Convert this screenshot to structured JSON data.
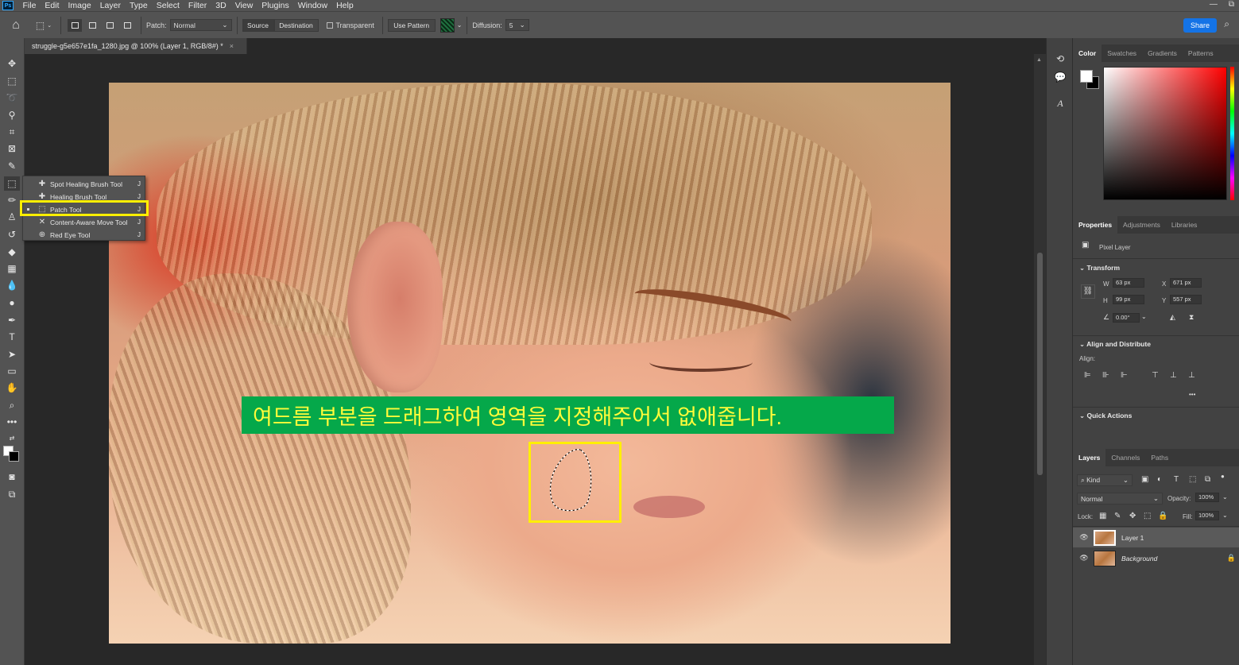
{
  "menubar": {
    "logo": "Ps",
    "items": [
      "File",
      "Edit",
      "Image",
      "Layer",
      "Type",
      "Select",
      "Filter",
      "3D",
      "View",
      "Plugins",
      "Window",
      "Help"
    ],
    "win_min": "—",
    "win_restore": "⧉"
  },
  "options": {
    "patch_label": "Patch:",
    "patch_value": "Normal",
    "source": "Source",
    "destination": "Destination",
    "transparent": "Transparent",
    "use_pattern": "Use Pattern",
    "diffusion_label": "Diffusion:",
    "diffusion_value": "5",
    "share": "Share"
  },
  "document": {
    "tab_title": "struggle-g5e657e1fa_1280.jpg @ 100% (Layer 1, RGB/8#) *",
    "close": "×"
  },
  "flyout": {
    "items": [
      {
        "label": "Spot Healing Brush Tool",
        "key": "J"
      },
      {
        "label": "Healing Brush Tool",
        "key": "J"
      },
      {
        "label": "Patch Tool",
        "key": "J"
      },
      {
        "label": "Content-Aware Move Tool",
        "key": "J"
      },
      {
        "label": "Red Eye Tool",
        "key": "J"
      }
    ]
  },
  "annotation": {
    "banner_text": "여드름 부분을 드래그하여 영역을 지정해주어서 없애줍니다.",
    "banner_bg": "#05a84a",
    "banner_fg": "#fffb3a",
    "highlight_color": "#ffef00"
  },
  "panels": {
    "color_tabs": [
      "Color",
      "Swatches",
      "Gradients",
      "Patterns"
    ],
    "prop_tabs": [
      "Properties",
      "Adjustments",
      "Libraries"
    ],
    "pixel_layer": "Pixel Layer",
    "transform": "Transform",
    "w_label": "W",
    "w_value": "63 px",
    "h_label": "H",
    "h_value": "99 px",
    "x_label": "X",
    "x_value": "671 px",
    "y_label": "Y",
    "y_value": "557 px",
    "angle_value": "0.00°",
    "align_distribute": "Align and Distribute",
    "align_label": "Align:",
    "quick_actions": "Quick Actions",
    "layer_tabs": [
      "Layers",
      "Channels",
      "Paths"
    ],
    "kind": "Kind",
    "blend_mode": "Normal",
    "opacity_label": "Opacity:",
    "opacity_value": "100%",
    "lock_label": "Lock:",
    "fill_label": "Fill:",
    "fill_value": "100%",
    "layers": [
      {
        "name": "Layer 1"
      },
      {
        "name": "Background"
      }
    ]
  }
}
